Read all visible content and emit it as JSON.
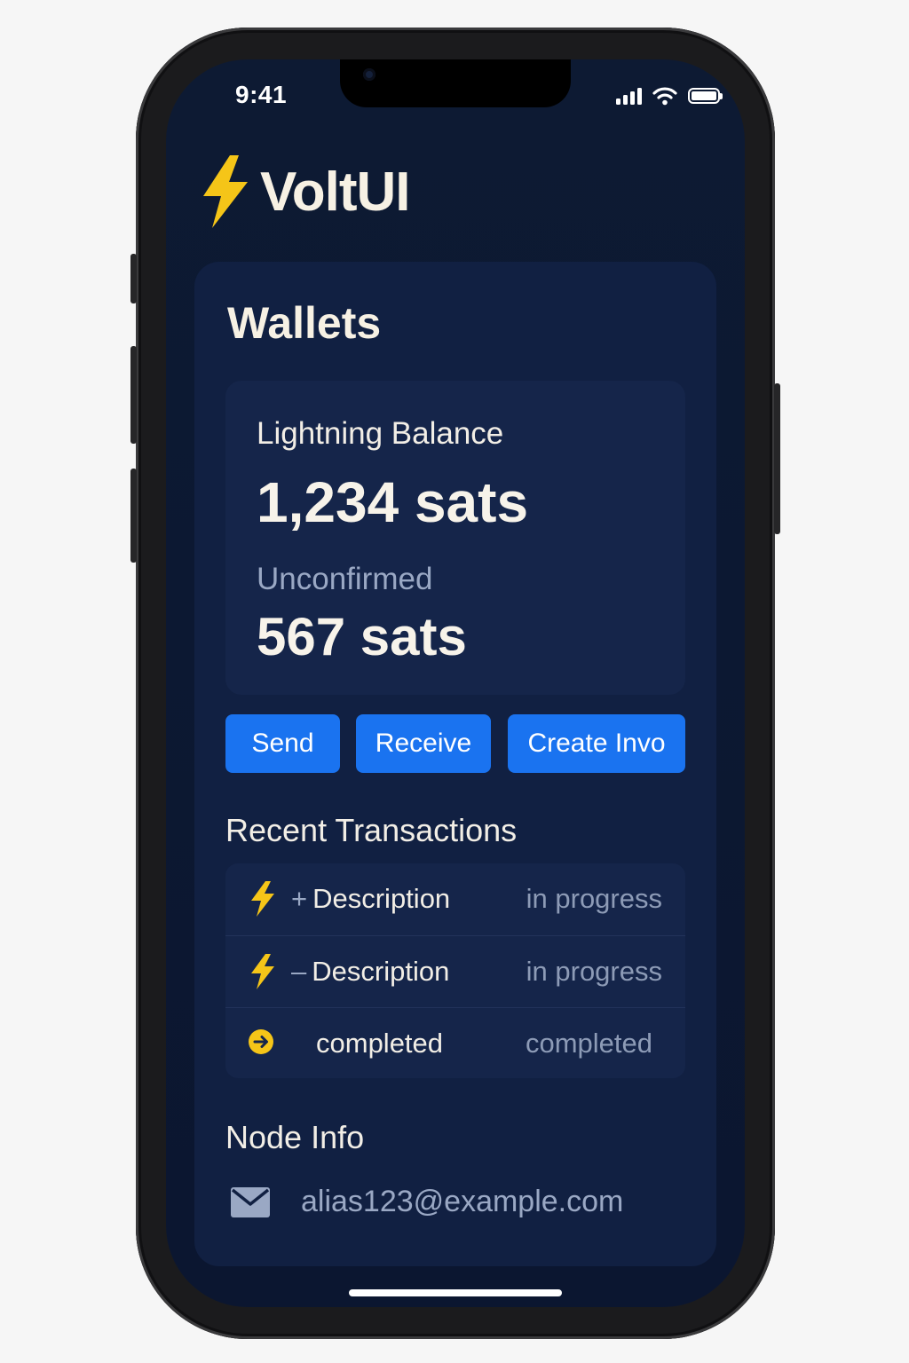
{
  "status_bar": {
    "time": "9:41"
  },
  "app": {
    "name": "VoltUI"
  },
  "wallets": {
    "title": "Wallets",
    "balance_label": "Lightning Balance",
    "balance_value": "1,234 sats",
    "unconfirmed_label": "Unconfirmed",
    "unconfirmed_value": "567 sats"
  },
  "actions": {
    "send": "Send",
    "receive": "Receive",
    "create_invoice": "Create Invo"
  },
  "transactions": {
    "title": "Recent Transactions",
    "items": [
      {
        "icon": "lightning-bolt-icon",
        "sign": "+",
        "description": "Description",
        "status": "in progress"
      },
      {
        "icon": "lightning-bolt-icon",
        "sign": "–",
        "description": "Description",
        "status": "in progress"
      },
      {
        "icon": "arrow-right-circle-icon",
        "sign": "",
        "description": "completed",
        "status": "completed"
      }
    ]
  },
  "node_info": {
    "title": "Node Info",
    "email": "alias123@example.com",
    "icon": "mail-icon"
  },
  "colors": {
    "accent_blue": "#1a73f0",
    "bolt_yellow": "#f5c518",
    "background": "#0d1a33",
    "panel": "#112042"
  }
}
